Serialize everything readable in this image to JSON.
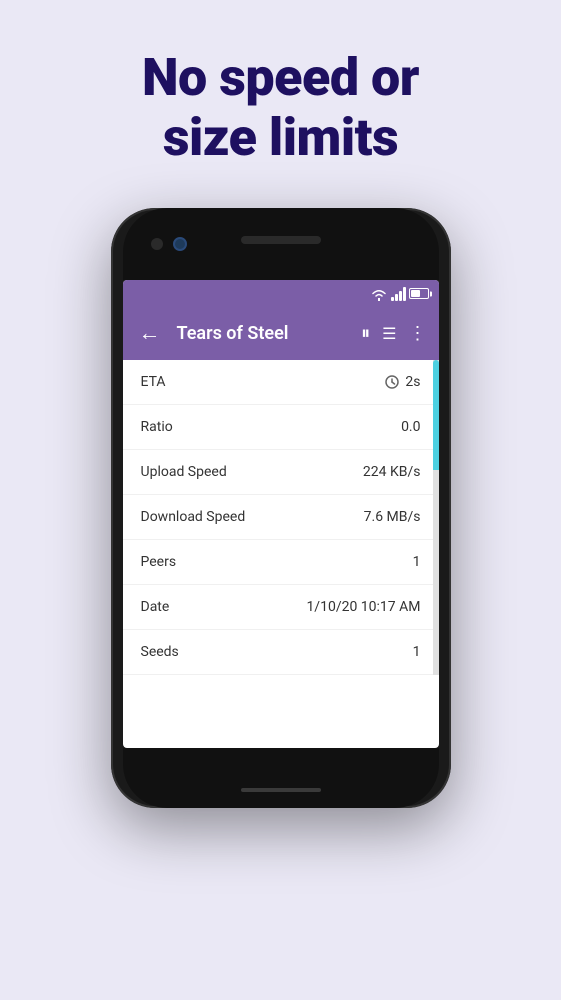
{
  "headline": {
    "line1": "No speed or",
    "line2": "size limits"
  },
  "background_color": "#eae8f5",
  "app_bar": {
    "title": "Tears of Steel",
    "back_label": "←",
    "pause_label": "⏸",
    "list_label": "☰",
    "more_label": "⋮"
  },
  "info_rows": [
    {
      "label": "ETA",
      "value": "2s",
      "has_clock": true
    },
    {
      "label": "Ratio",
      "value": "0.0"
    },
    {
      "label": "Upload Speed",
      "value": "224 KB/s"
    },
    {
      "label": "Download Speed",
      "value": "7.6 MB/s"
    },
    {
      "label": "Peers",
      "value": "1"
    },
    {
      "label": "Date",
      "value": "1/10/20 10:17 AM"
    },
    {
      "label": "Seeds",
      "value": "1"
    }
  ],
  "status_bar": {
    "wifi": "wifi",
    "signal": "signal",
    "battery": "battery"
  }
}
